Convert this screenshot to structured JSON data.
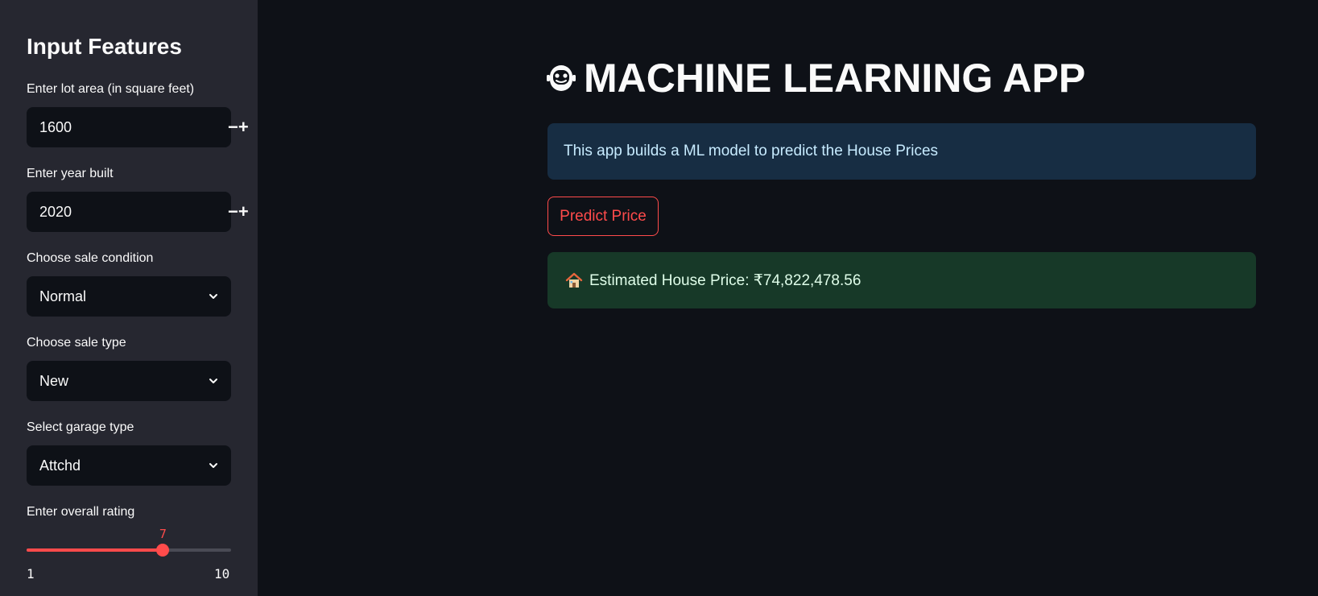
{
  "sidebar": {
    "title": "Input Features",
    "lot_area": {
      "label": "Enter lot area (in square feet)",
      "value": "1600",
      "minus": "−",
      "plus": "+"
    },
    "year_built": {
      "label": "Enter year built",
      "value": "2020",
      "minus": "−",
      "plus": "+"
    },
    "sale_condition": {
      "label": "Choose sale condition",
      "selected": "Normal"
    },
    "sale_type": {
      "label": "Choose sale type",
      "selected": "New"
    },
    "garage_type": {
      "label": "Select garage type",
      "selected": "Attchd"
    },
    "overall_rating": {
      "label": "Enter overall rating",
      "value": 7,
      "value_label": "7",
      "min": 1,
      "max": 10,
      "min_label": "1",
      "max_label": "10"
    }
  },
  "main": {
    "title": "MACHINE LEARNING APP",
    "title_icon": "robot-face-icon",
    "info_text": "This app builds a ML model to predict the House Prices",
    "predict_button": "Predict Price",
    "result_icon": "house-icon",
    "result_text": "Estimated House Price: ₹74,822,478.56"
  },
  "colors": {
    "accent": "#ff4b4b",
    "background": "#0e1117",
    "sidebar": "#262730",
    "info_bg": "#172d43",
    "success_bg": "#173928"
  }
}
